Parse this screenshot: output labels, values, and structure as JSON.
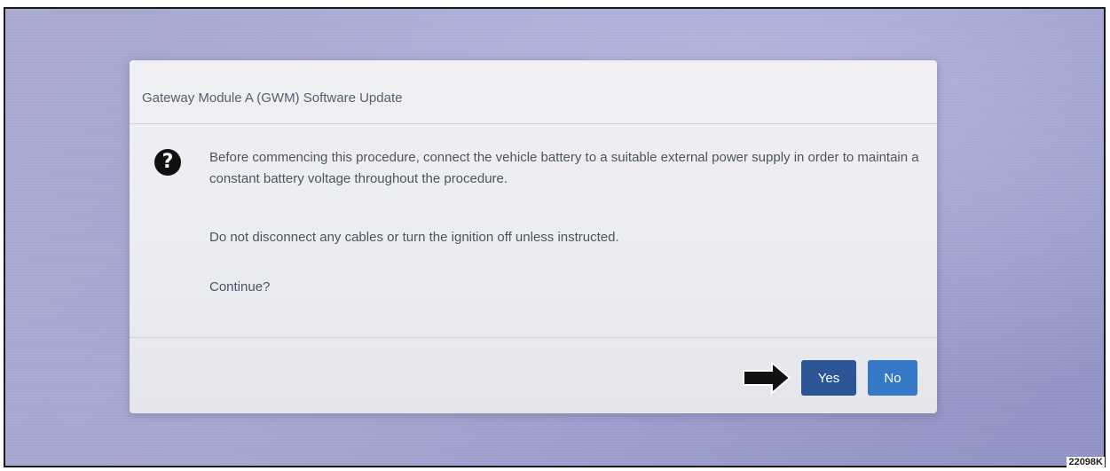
{
  "dialog": {
    "title": "Gateway Module A (GWM) Software Update",
    "icon": "question-circle-icon",
    "message_1": "Before commencing this procedure, connect the vehicle battery to a suitable external power supply in order to maintain a constant battery voltage throughout the procedure.",
    "message_2": "Do not disconnect any cables or turn the ignition off unless instructed.",
    "message_3": "Continue?",
    "yes_label": "Yes",
    "no_label": "No"
  },
  "reference_code": "22098K",
  "colors": {
    "yes_button": "#2c5595",
    "no_button": "#3478c6",
    "heading_note": "#e23b2f"
  }
}
